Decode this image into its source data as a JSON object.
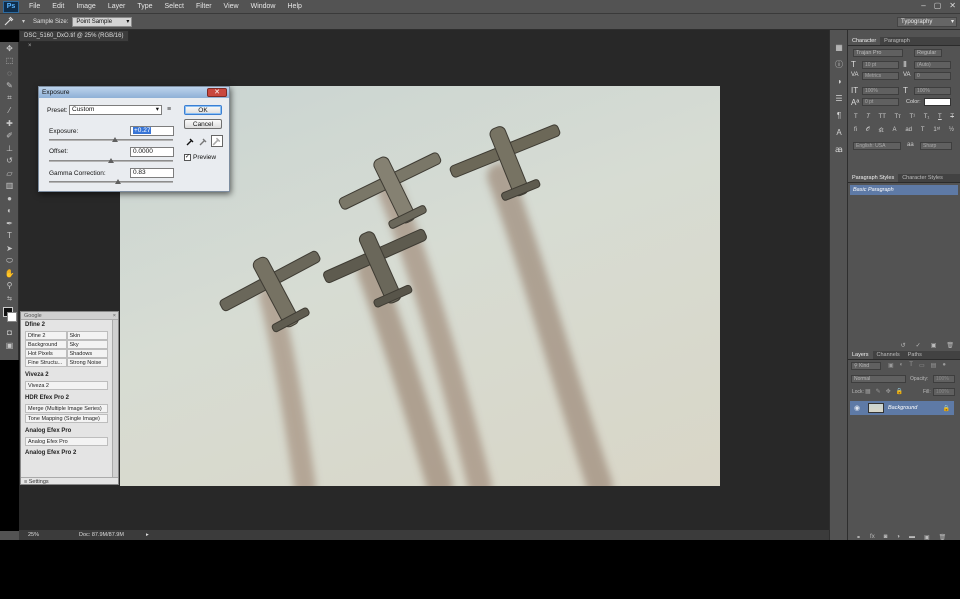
{
  "menubar": {
    "logo": "Ps",
    "items": [
      "File",
      "Edit",
      "Image",
      "Layer",
      "Type",
      "Select",
      "Filter",
      "View",
      "Window",
      "Help"
    ],
    "window_controls": [
      "–",
      "▢",
      "✕"
    ]
  },
  "options_bar": {
    "sample_size_label": "Sample Size:",
    "sample_size_value": "Point Sample",
    "workspace": "Typography"
  },
  "document": {
    "tab_title": "DSC_5160_DxO.tif @ 25% (RGB/16)",
    "zoom": "25%",
    "doc_info": "Doc: 87.9M/87.9M"
  },
  "exposure_dialog": {
    "title": "Exposure",
    "preset_label": "Preset:",
    "preset_value": "Custom",
    "exposure_label": "Exposure:",
    "exposure_value": "+0.27",
    "exposure_slider": 0.53,
    "offset_label": "Offset:",
    "offset_value": "0.0000",
    "offset_slider": 0.5,
    "gamma_label": "Gamma Correction:",
    "gamma_value": "0.83",
    "gamma_slider": 0.56,
    "ok_label": "OK",
    "cancel_label": "Cancel",
    "preview_label": "Preview",
    "preview_checked": true
  },
  "google_panel": {
    "title": "Google",
    "sections": [
      {
        "title": "Dfine 2",
        "grid": [
          "Dfine 2",
          "Skin",
          "Background",
          "Sky",
          "Hot Pixels",
          "Shadows",
          "Fine Structu...",
          "Strong Noise"
        ]
      },
      {
        "title": "Viveza 2",
        "items": [
          "Viveza 2"
        ]
      },
      {
        "title": "HDR Efex Pro 2",
        "items": [
          "Merge (Multiple Image Series)",
          "Tone Mapping (Single Image)"
        ]
      },
      {
        "title": "Analog Efex Pro",
        "items": [
          "Analog Efex Pro"
        ]
      },
      {
        "title": "Analog Efex Pro 2",
        "items": []
      }
    ],
    "settings_label": "Settings"
  },
  "character_panel": {
    "tabs": [
      "Character",
      "Paragraph"
    ],
    "font_family": "Trajan Pro",
    "font_style": "Regular",
    "font_size": "10 pt",
    "leading": "(Auto)",
    "kerning": "Metrics",
    "tracking": "0",
    "vertical_scale": "100%",
    "horizontal_scale": "100%",
    "baseline_shift": "0 pt",
    "color_label": "Color:",
    "language": "English: USA",
    "aa_label": "aa",
    "antialias": "Sharp"
  },
  "styles_panel": {
    "tabs": [
      "Paragraph Styles",
      "Character Styles"
    ],
    "selected": "Basic Paragraph"
  },
  "layers_panel": {
    "tabs": [
      "Layers",
      "Channels",
      "Paths"
    ],
    "kind_label": "Kind",
    "blend_mode": "Normal",
    "opacity_label": "Opacity:",
    "opacity_value": "100%",
    "lock_label": "Lock:",
    "fill_label": "Fill:",
    "fill_value": "100%",
    "layer_name": "Background"
  },
  "colors": {
    "app_bg": "#535353",
    "doc_bg": "#282828",
    "selection_blue": "#5e7aa6",
    "dialog_title": "#8fb0d6",
    "close_red": "#c9473e"
  }
}
